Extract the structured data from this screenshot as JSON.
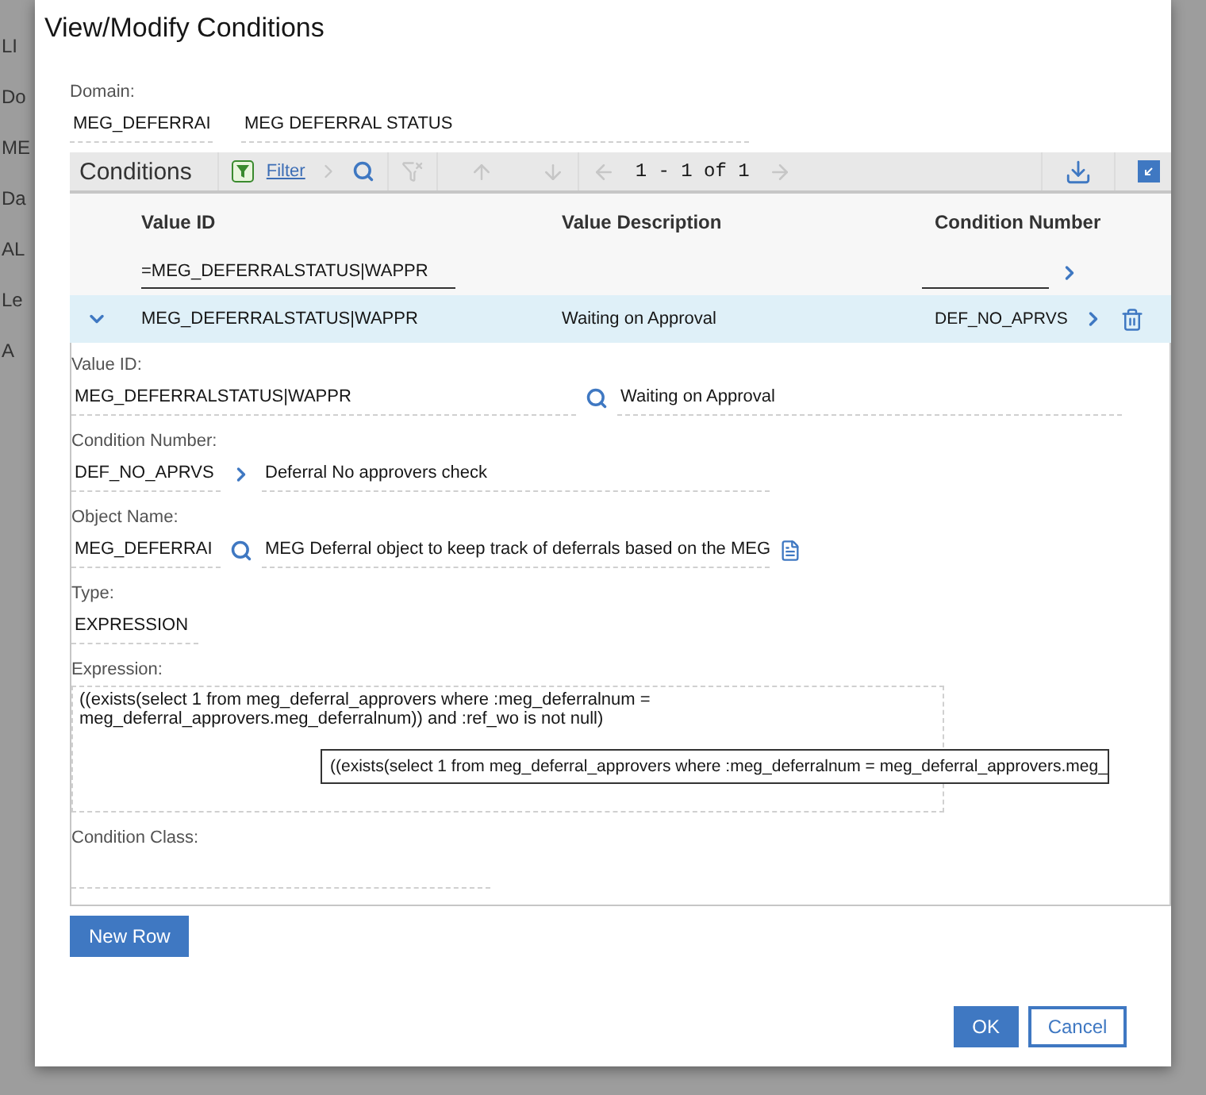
{
  "background": {
    "texts": [
      "LI",
      "Do",
      "ME",
      "Da",
      "AL",
      "Le",
      "A"
    ]
  },
  "dialog": {
    "title": "View/Modify Conditions"
  },
  "domain": {
    "label": "Domain:",
    "value": "MEG_DEFERRAI",
    "description": "MEG DEFERRAL STATUS"
  },
  "table": {
    "title": "Conditions",
    "filter_label": "Filter",
    "pagination": "1 - 1 of 1",
    "columns": [
      "Value ID",
      "Value Description",
      "Condition Number"
    ],
    "filter_value": "=MEG_DEFERRALSTATUS|WAPPR",
    "rows": [
      {
        "value_id": "MEG_DEFERRALSTATUS|WAPPR",
        "description": "Waiting on Approval",
        "condition_number": "DEF_NO_APRVS",
        "selected": true,
        "expanded": true
      }
    ]
  },
  "details": {
    "fields": [
      {
        "kind": "search",
        "label": "Value ID:",
        "value": "MEG_DEFERRALSTATUS|WAPPR",
        "description": "Waiting on Approval"
      },
      {
        "kind": "chevron",
        "label": "Condition Number:",
        "value": "DEF_NO_APRVS",
        "description": "Deferral No approvers check"
      },
      {
        "kind": "search_detail",
        "label": "Object Name:",
        "value": "MEG_DEFERRAI",
        "description": "MEG Deferral object to keep track of deferrals based on the MEG"
      },
      {
        "kind": "plain",
        "label": "Type:",
        "value": "EXPRESSION"
      },
      {
        "kind": "textarea",
        "label": "Expression:",
        "value": "((exists(select 1 from meg_deferral_approvers where :meg_deferralnum = meg_deferral_approvers.meg_deferralnum)) and :ref_wo is not null)"
      },
      {
        "kind": "plain",
        "label": "Condition Class:"
      }
    ]
  },
  "tooltip": "((exists(select 1 from meg_deferral_approvers where :meg_deferralnum = meg_deferral_approvers.meg_",
  "new_row_button": "New Row",
  "buttons": [
    {
      "label": "OK",
      "kind": "primary"
    },
    {
      "label": "Cancel",
      "kind": "secondary"
    }
  ]
}
